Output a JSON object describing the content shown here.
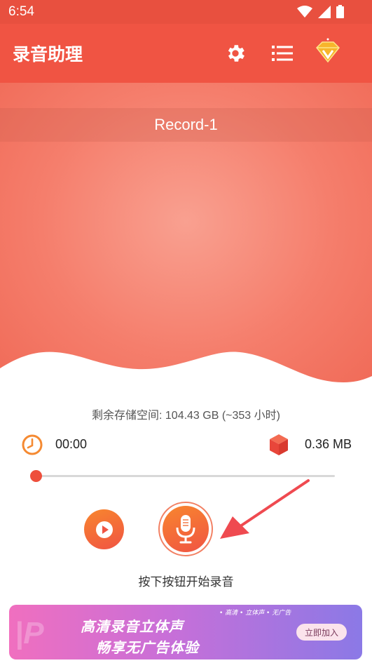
{
  "status_bar": {
    "time": "6:54"
  },
  "app_bar": {
    "title": "录音助理",
    "settings_icon": "gear-icon",
    "list_icon": "list-icon",
    "vip_icon": "diamond-icon"
  },
  "recording": {
    "name": "Record-1"
  },
  "storage": {
    "text": "剩余存储空间: 104.43 GB (~353 小时)"
  },
  "stats": {
    "duration": "00:00",
    "size": "0.36 MB"
  },
  "progress": {
    "value": 0
  },
  "controls": {
    "hint": "按下按钮开始录音"
  },
  "ad": {
    "tagline": "• 高清 • 立体声 • 无广告",
    "line1": "高清录音立体声",
    "line2": "畅享无广告体验",
    "cta": "立即加入"
  },
  "colors": {
    "primary": "#f05443",
    "accent": "#f8862e"
  }
}
